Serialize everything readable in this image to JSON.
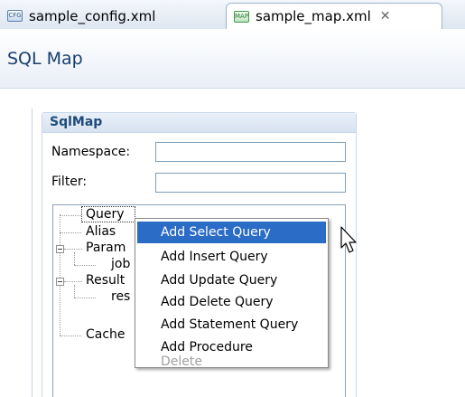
{
  "tabs": [
    {
      "label": "sample_config.xml",
      "icon": "cfg-file-icon",
      "icon_text": "CFG"
    },
    {
      "label": "sample_map.xml",
      "icon": "map-file-icon",
      "icon_text": "MAP",
      "close": "✕"
    }
  ],
  "header": {
    "title": "SQL Map"
  },
  "section": {
    "title": "SqlMap",
    "namespace_label": "Namespace:",
    "namespace_value": "",
    "filter_label": "Filter:",
    "filter_value": ""
  },
  "tree": {
    "items": [
      "Query",
      "Alias",
      "Param",
      "job",
      "Result",
      "res",
      "Cache"
    ]
  },
  "context_menu": {
    "items": [
      {
        "label": "Add Select Query",
        "highlighted": true,
        "disabled": false
      },
      {
        "label": "Add Insert Query",
        "highlighted": false,
        "disabled": false
      },
      {
        "label": "Add Update Query",
        "highlighted": false,
        "disabled": false
      },
      {
        "label": "Add Delete Query",
        "highlighted": false,
        "disabled": false
      },
      {
        "label": "Add Statement Query",
        "highlighted": false,
        "disabled": false
      },
      {
        "label": "Add Procedure",
        "highlighted": false,
        "disabled": false
      },
      {
        "label": "Delete",
        "highlighted": false,
        "disabled": true
      }
    ]
  },
  "colors": {
    "highlight": "#2b6cc6",
    "title": "#1a3f6e",
    "section_title": "#1f4a7a"
  }
}
